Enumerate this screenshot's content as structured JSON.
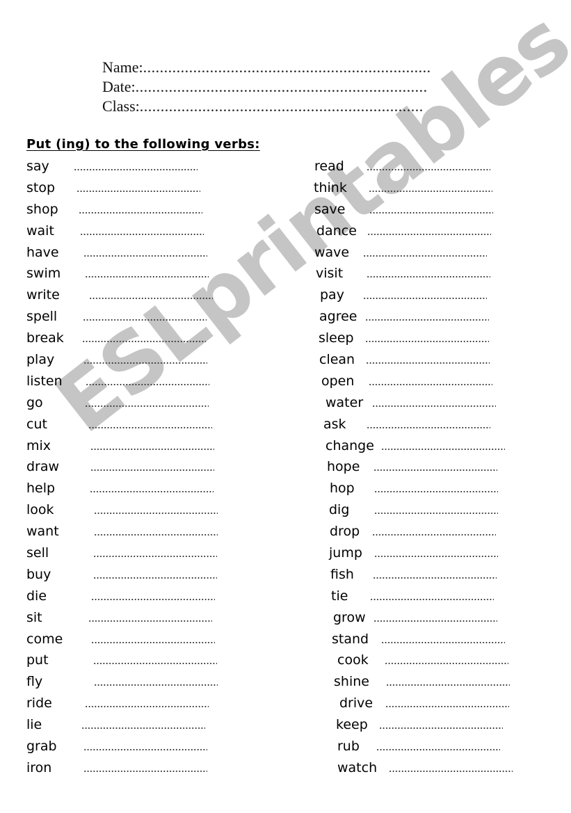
{
  "header": {
    "fields": [
      {
        "label": "Name:",
        "dots": "....................................................................."
      },
      {
        "label": "Date:",
        "dots": "......................................................................"
      },
      {
        "label": "Class:",
        "dots": "...................................................................."
      }
    ]
  },
  "instruction": "Put (ing) to the following verbs:",
  "left_column": [
    {
      "verb": "say",
      "answer": ""
    },
    {
      "verb": "stop",
      "answer": ""
    },
    {
      "verb": "shop",
      "answer": ""
    },
    {
      "verb": "wait",
      "answer": ""
    },
    {
      "verb": "have",
      "answer": ""
    },
    {
      "verb": "swim",
      "answer": ""
    },
    {
      "verb": "write",
      "answer": ""
    },
    {
      "verb": "spell",
      "answer": ""
    },
    {
      "verb": "break",
      "answer": ""
    },
    {
      "verb": "play",
      "answer": ""
    },
    {
      "verb": "listen",
      "answer": ""
    },
    {
      "verb": "go",
      "answer": ""
    },
    {
      "verb": "cut",
      "answer": ""
    },
    {
      "verb": "mix",
      "answer": ""
    },
    {
      "verb": "draw",
      "answer": ""
    },
    {
      "verb": "help",
      "answer": ""
    },
    {
      "verb": "look",
      "answer": ""
    },
    {
      "verb": "want",
      "answer": ""
    },
    {
      "verb": "sell",
      "answer": ""
    },
    {
      "verb": "buy",
      "answer": ""
    },
    {
      "verb": "die",
      "answer": ""
    },
    {
      "verb": "sit",
      "answer": ""
    },
    {
      "verb": "come",
      "answer": ""
    },
    {
      "verb": "put",
      "answer": ""
    },
    {
      "verb": "fly",
      "answer": ""
    },
    {
      "verb": "ride",
      "answer": ""
    },
    {
      "verb": "lie",
      "answer": ""
    },
    {
      "verb": "grab",
      "answer": ""
    },
    {
      "verb": "iron",
      "answer": ""
    }
  ],
  "right_column": [
    {
      "verb": "read",
      "answer": ""
    },
    {
      "verb": "think",
      "answer": ""
    },
    {
      "verb": "save",
      "answer": ""
    },
    {
      "verb": "dance",
      "answer": ""
    },
    {
      "verb": "wave",
      "answer": ""
    },
    {
      "verb": "visit",
      "answer": ""
    },
    {
      "verb": "pay",
      "answer": ""
    },
    {
      "verb": "agree",
      "answer": ""
    },
    {
      "verb": "sleep",
      "answer": ""
    },
    {
      "verb": "clean",
      "answer": ""
    },
    {
      "verb": "open",
      "answer": ""
    },
    {
      "verb": "water",
      "answer": ""
    },
    {
      "verb": "ask",
      "answer": ""
    },
    {
      "verb": "change",
      "answer": ""
    },
    {
      "verb": "hope",
      "answer": ""
    },
    {
      "verb": "hop",
      "answer": ""
    },
    {
      "verb": "dig",
      "answer": ""
    },
    {
      "verb": "drop",
      "answer": ""
    },
    {
      "verb": "jump",
      "answer": ""
    },
    {
      "verb": "fish",
      "answer": ""
    },
    {
      "verb": "tie",
      "answer": ""
    },
    {
      "verb": "grow",
      "answer": ""
    },
    {
      "verb": "stand",
      "answer": ""
    },
    {
      "verb": "cook",
      "answer": ""
    },
    {
      "verb": "shine",
      "answer": ""
    },
    {
      "verb": "drive",
      "answer": ""
    },
    {
      "verb": "keep",
      "answer": ""
    },
    {
      "verb": "rub",
      "answer": ""
    },
    {
      "verb": "watch",
      "answer": ""
    }
  ],
  "watermark": "ESLprintables.com"
}
